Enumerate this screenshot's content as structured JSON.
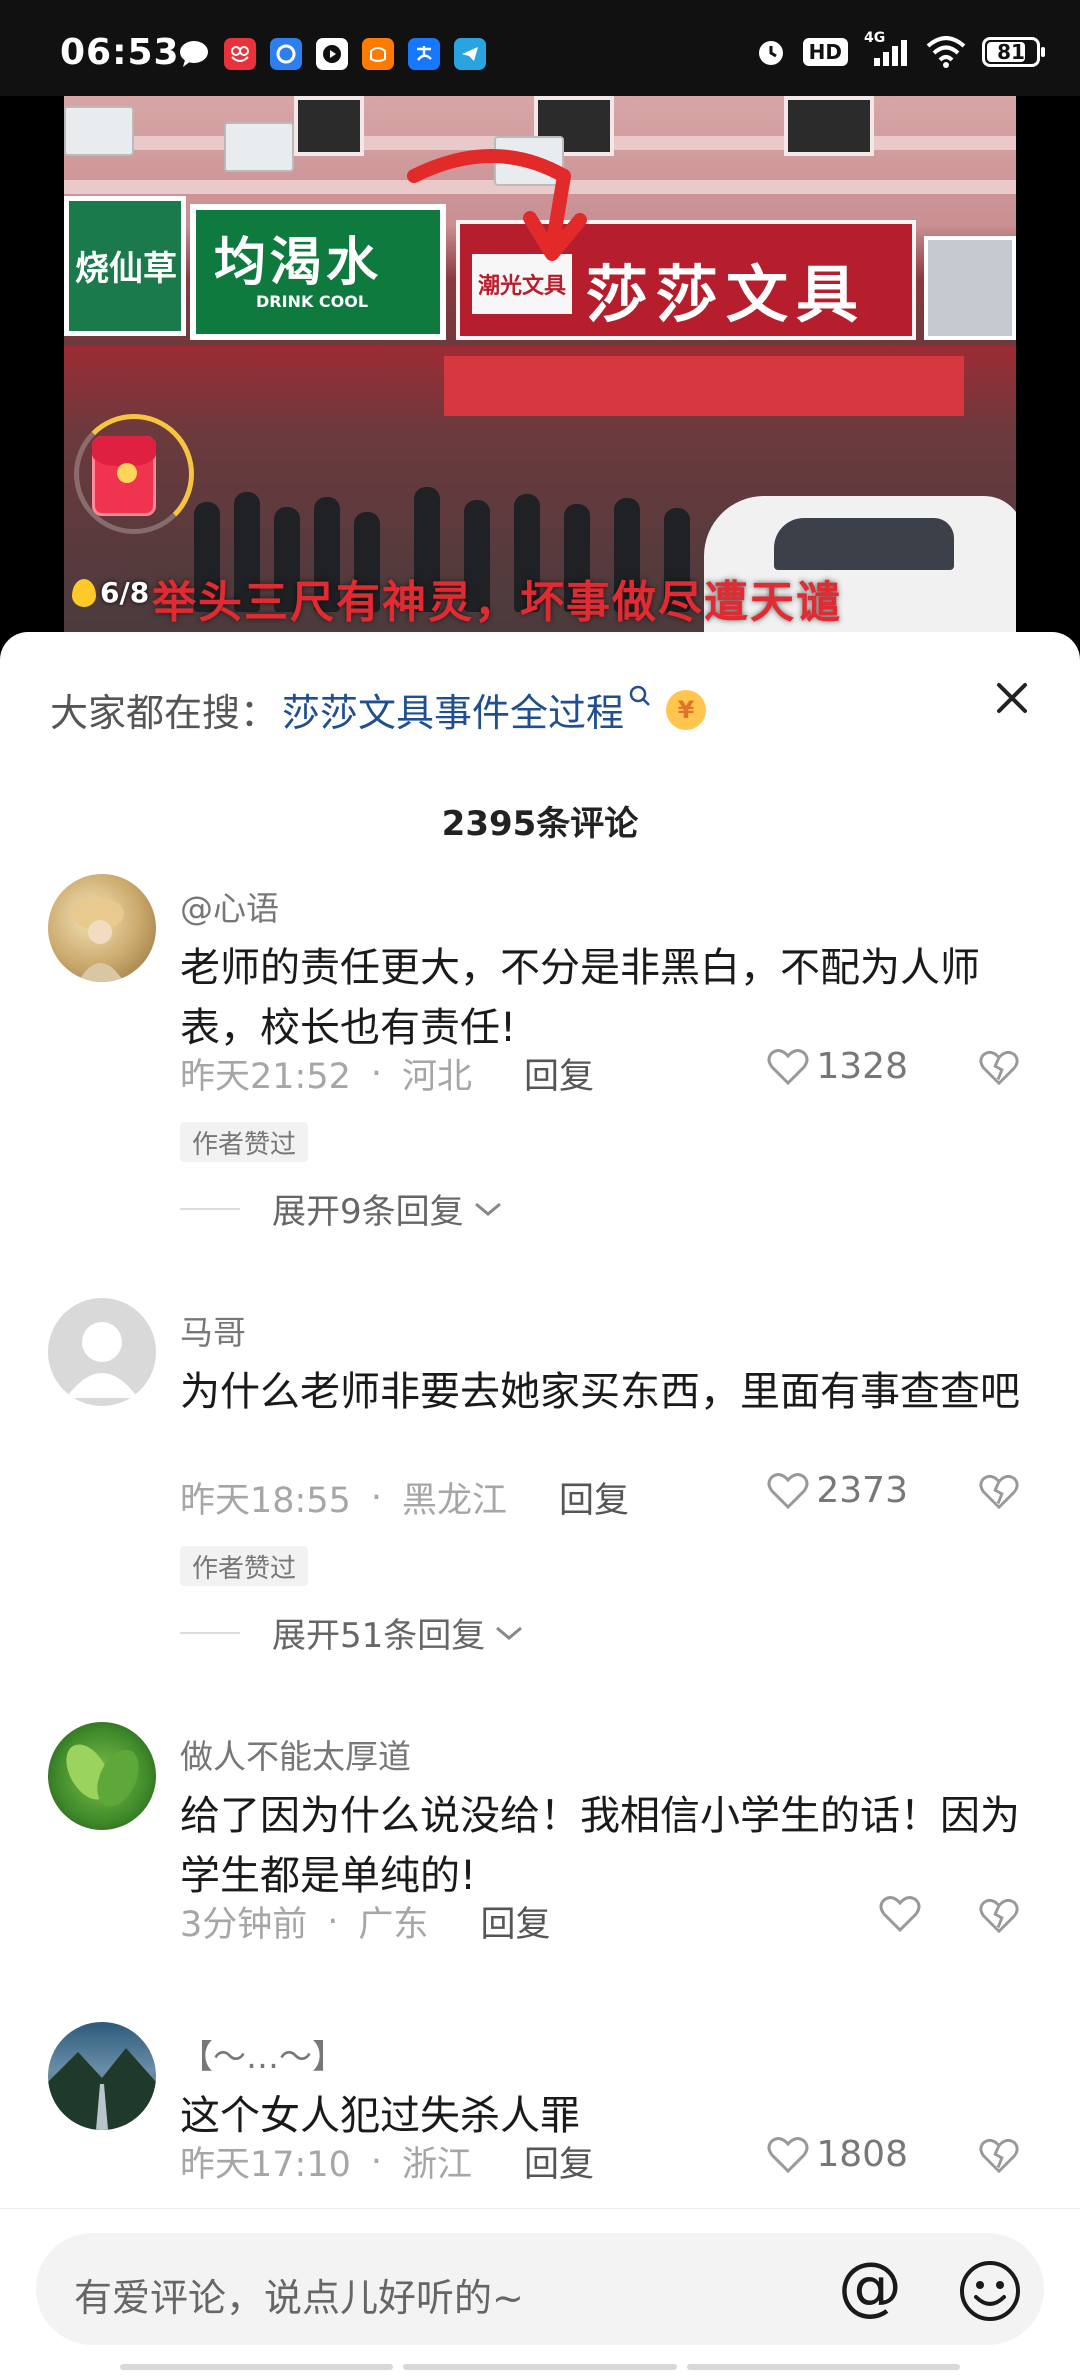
{
  "status_bar": {
    "time": "06:53",
    "hd_label": "HD",
    "network_label": "4G",
    "battery": "81",
    "battery_fraction": 0.81,
    "app_icons": [
      "chat-bubble-icon",
      "shopping-app-icon",
      "browser-app-icon",
      "video-app-icon",
      "taobao-icon",
      "alipay-icon",
      "telegram-icon"
    ]
  },
  "video": {
    "shop_sign_main": "莎莎文具",
    "shop_sign_small": "潮光文具",
    "drink_sign": "均渴水",
    "drink_sub": "DRINK COOL",
    "left_sign": "烧仙草",
    "overlay_caption": "举头三尺有神灵，坏事做尽遭天谴",
    "packet_counter": "6/8"
  },
  "search": {
    "lead": "大家都在搜：",
    "query": "莎莎文具事件全过程",
    "coin_symbol": "¥"
  },
  "comment_count": "2395条评论",
  "comments": [
    {
      "user": "@心语",
      "text": "老师的责任更大，不分是非黑白，不配为人师表，校长也有责任!",
      "time": "昨天21:52",
      "location": "河北",
      "reply": "回复",
      "likes": "1328",
      "author_tag": "作者赞过",
      "expand": "展开9条回复"
    },
    {
      "user": "马哥",
      "text": "为什么老师非要去她家买东西，里面有事查查吧",
      "time": "昨天18:55",
      "location": "黑龙江",
      "reply": "回复",
      "likes": "2373",
      "author_tag": "作者赞过",
      "expand": "展开51条回复"
    },
    {
      "user": "做人不能太厚道",
      "text": "给了因为什么说没给！我相信小学生的话！因为学生都是单纯的!",
      "time": "3分钟前",
      "location": "广东",
      "reply": "回复",
      "likes": ""
    },
    {
      "user": "【～…～】",
      "text": "这个女人犯过失杀人罪",
      "time": "昨天17:10",
      "location": "浙江",
      "reply": "回复",
      "likes": "1808"
    }
  ],
  "input": {
    "placeholder": "有爱评论，说点儿好听的~",
    "at_symbol": "@"
  },
  "colors": {
    "link_blue": "#1f4f8f",
    "caption_red": "#e12b33",
    "meta_gray": "#a6a6a6"
  }
}
